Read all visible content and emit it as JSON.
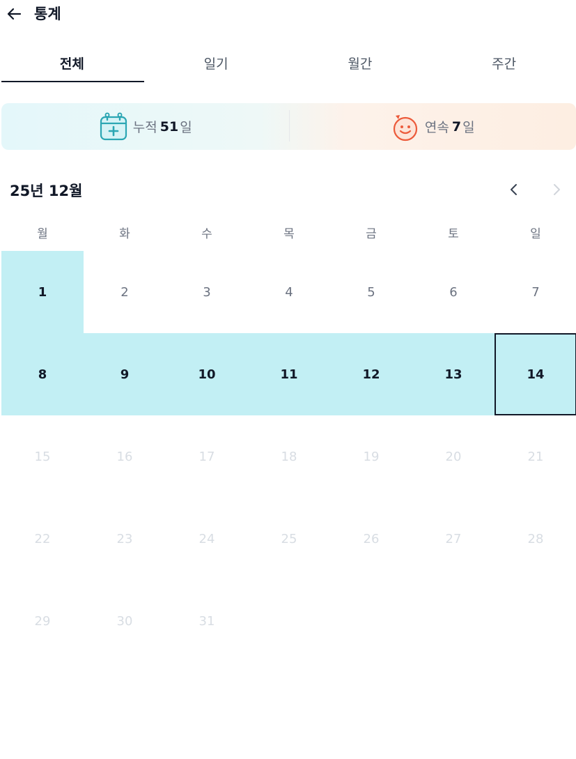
{
  "header": {
    "title": "통계",
    "back_icon": "arrow-left-icon"
  },
  "tabs": [
    {
      "label": "전체",
      "active": true
    },
    {
      "label": "일기",
      "active": false
    },
    {
      "label": "월간",
      "active": false
    },
    {
      "label": "주간",
      "active": false
    }
  ],
  "stats": {
    "cumulative": {
      "prefix": "누적",
      "value": "51",
      "suffix": "일",
      "icon": "calendar-plus-icon",
      "color": "#2ba6b3"
    },
    "streak": {
      "prefix": "연속",
      "value": "7",
      "suffix": "일",
      "icon": "smiley-face-icon",
      "color": "#ec5a3a"
    }
  },
  "calendar": {
    "month_title": "25년 12월",
    "weekdays": [
      "월",
      "화",
      "수",
      "목",
      "금",
      "토",
      "일"
    ],
    "days": [
      "1",
      "2",
      "3",
      "4",
      "5",
      "6",
      "7",
      "8",
      "9",
      "10",
      "11",
      "12",
      "13",
      "14",
      "15",
      "16",
      "17",
      "18",
      "19",
      "20",
      "21",
      "22",
      "23",
      "24",
      "25",
      "26",
      "27",
      "28",
      "29",
      "30",
      "31"
    ],
    "recorded_days": [
      1,
      8,
      9,
      10,
      11,
      12,
      13,
      14
    ],
    "today": 14,
    "highlight_color": "#c2eff4"
  }
}
